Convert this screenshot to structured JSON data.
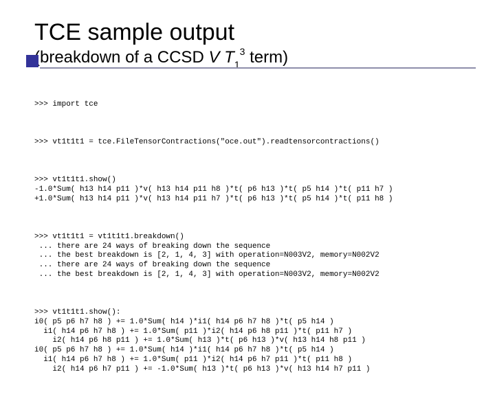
{
  "title": {
    "main": "TCE sample output",
    "sub_prefix": "(breakdown of a CCSD ",
    "sub_var1": "V",
    "sub_between": " ",
    "sub_var2": "T",
    "sub_sub": "1",
    "sub_sup": "3",
    "sub_suffix": " term)"
  },
  "code": {
    "block1": ">>> import tce",
    "block2": ">>> vt1t1t1 = tce.FileTensorContractions(\"oce.out\").readtensorcontractions()",
    "block3": ">>> vt1t1t1.show()\n-1.0*Sum( h13 h14 p11 )*v( h13 h14 p11 h8 )*t( p6 h13 )*t( p5 h14 )*t( p11 h7 )\n+1.0*Sum( h13 h14 p11 )*v( h13 h14 p11 h7 )*t( p6 h13 )*t( p5 h14 )*t( p11 h8 )",
    "block4": ">>> vt1t1t1 = vt1t1t1.breakdown()\n ... there are 24 ways of breaking down the sequence\n ... the best breakdown is [2, 1, 4, 3] with operation=N003V2, memory=N002V2\n ... there are 24 ways of breaking down the sequence\n ... the best breakdown is [2, 1, 4, 3] with operation=N003V2, memory=N002V2",
    "block5": ">>> vt1t1t1.show():\ni0( p5 p6 h7 h8 ) += 1.0*Sum( h14 )*i1( h14 p6 h7 h8 )*t( p5 h14 )\n  i1( h14 p6 h7 h8 ) += 1.0*Sum( p11 )*i2( h14 p6 h8 p11 )*t( p11 h7 )\n    i2( h14 p6 h8 p11 ) += 1.0*Sum( h13 )*t( p6 h13 )*v( h13 h14 h8 p11 )\ni0( p5 p6 h7 h8 ) += 1.0*Sum( h14 )*i1( h14 p6 h7 h8 )*t( p5 h14 )\n  i1( h14 p6 h7 h8 ) += 1.0*Sum( p11 )*i2( h14 p6 h7 p11 )*t( p11 h8 )\n    i2( h14 p6 h7 p11 ) += -1.0*Sum( h13 )*t( p6 h13 )*v( h13 h14 h7 p11 )"
  }
}
